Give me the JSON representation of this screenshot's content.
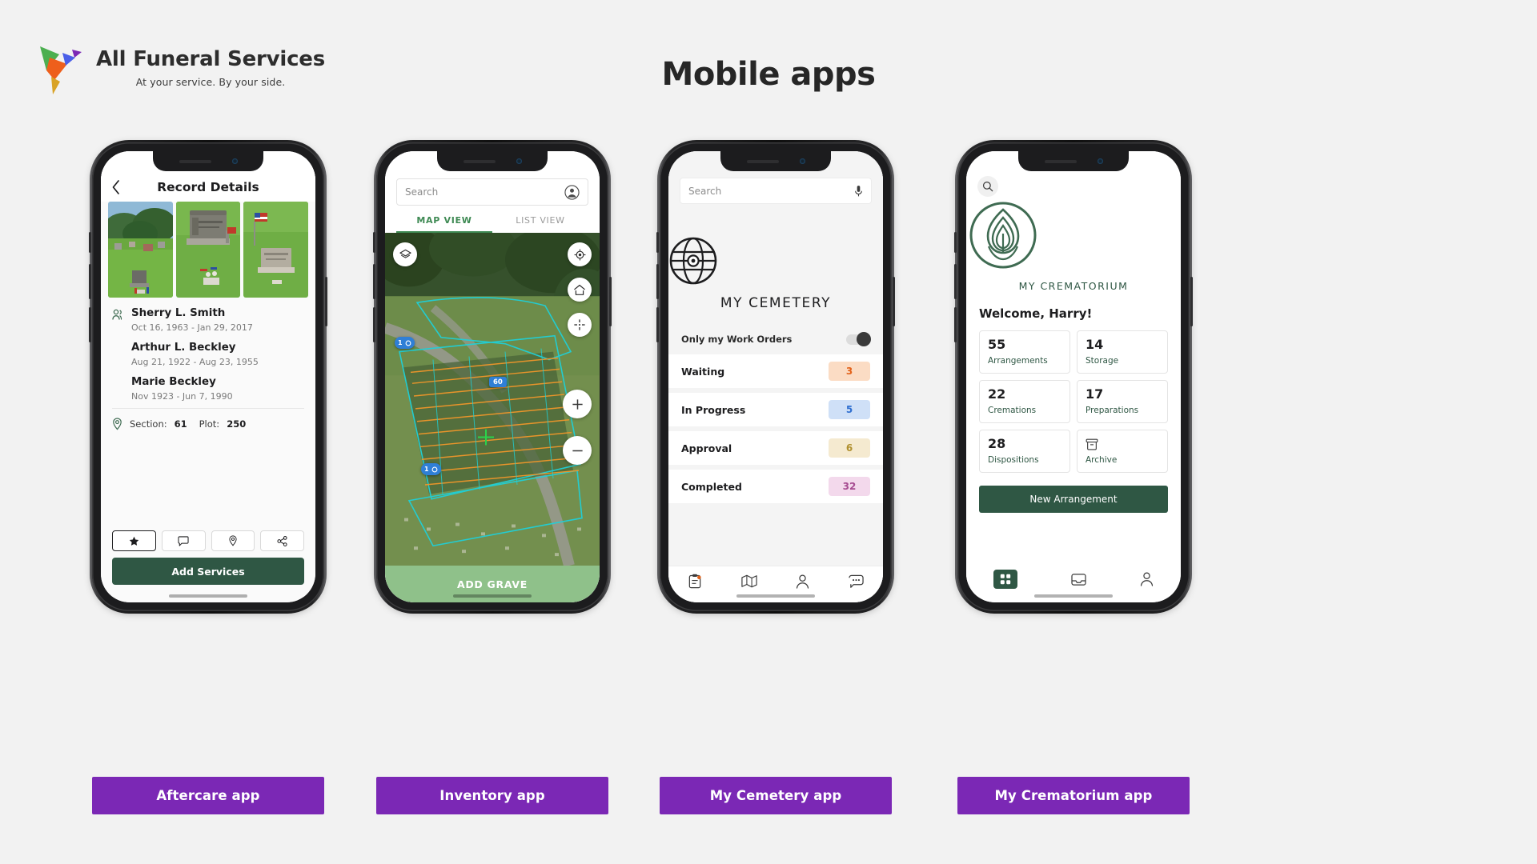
{
  "header": {
    "brand_name": "All Funeral Services",
    "tagline": "At your service. By your side.",
    "page_title": "Mobile apps",
    "logo_colors": {
      "green": "#4caf50",
      "orange": "#ee5f1c",
      "blue": "#4a5fe8",
      "purple": "#7b28b5",
      "gold": "#d9a326"
    }
  },
  "labels": {
    "aftercare": "Aftercare app",
    "inventory": "Inventory app",
    "cemetery": "My Cemetery app",
    "crematorium": "My Crematorium app",
    "label_color": "#7b28b5"
  },
  "aftercare": {
    "back_icon": "chevron-left-icon",
    "title": "Record Details",
    "photos": [
      "cemetery-landscape-photo",
      "beckley-headstone-photo",
      "headstone-flag-photo"
    ],
    "person_icon": "people-icon",
    "records": [
      {
        "name": "Sherry L. Smith",
        "dates": "Oct 16, 1963 - Jan 29, 2017"
      },
      {
        "name": "Arthur L. Beckley",
        "dates": "Aug 21, 1922 - Aug 23, 1955"
      },
      {
        "name": "Marie Beckley",
        "dates": "Nov 1923 - Jun 7, 1990"
      }
    ],
    "location_icon": "map-pin-icon",
    "section_label": "Section:",
    "section_value": "61",
    "plot_label": "Plot:",
    "plot_value": "250",
    "actions": [
      "star-icon",
      "comment-icon",
      "map-pin-icon",
      "share-icon"
    ],
    "cta": "Add Services",
    "cta_color": "#2f5744"
  },
  "inventory": {
    "search_placeholder": "Search",
    "account_icon": "account-circle-icon",
    "tabs": [
      {
        "label": "MAP VIEW",
        "active": true
      },
      {
        "label": "LIST VIEW",
        "active": false
      }
    ],
    "map_controls": [
      "layers-icon",
      "locate-icon",
      "home-icon",
      "center-crosshair-icon",
      "zoom-in-icon",
      "zoom-out-icon"
    ],
    "section_badge": "60",
    "pins": [
      {
        "count": "1"
      },
      {
        "count": "1"
      }
    ],
    "cta": "ADD GRAVE",
    "cta_color": "#8fc18a",
    "tab_active_color": "#3f8a54"
  },
  "cemetery": {
    "search_placeholder": "Search",
    "mic_icon": "microphone-icon",
    "logo_icon": "globe-grid-icon",
    "app_name": "MY CEMETERY",
    "toggle_label": "Only my Work Orders",
    "toggle_on": true,
    "statuses": [
      {
        "label": "Waiting",
        "count": "3",
        "bg": "#fbdcc4",
        "fg": "#e3621a"
      },
      {
        "label": "In Progress",
        "count": "5",
        "bg": "#cfe0f7",
        "fg": "#2f6fd0"
      },
      {
        "label": "Approval",
        "count": "6",
        "bg": "#f5ead0",
        "fg": "#b0902f"
      },
      {
        "label": "Completed",
        "count": "32",
        "bg": "#f3d9ec",
        "fg": "#a64b91"
      }
    ],
    "nav": [
      "clipboard-icon",
      "map-icon",
      "person-icon",
      "chat-icon"
    ]
  },
  "crematorium": {
    "search_icon": "search-icon",
    "logo_icon": "flame-leaf-icon",
    "app_name": "MY CREMATORIUM",
    "welcome": "Welcome, Harry!",
    "brand_color": "#2f5744",
    "stats": [
      {
        "value": "55",
        "label": "Arrangements"
      },
      {
        "value": "14",
        "label": "Storage"
      },
      {
        "value": "22",
        "label": "Cremations"
      },
      {
        "value": "17",
        "label": "Preparations"
      },
      {
        "value": "28",
        "label": "Dispositions"
      },
      {
        "value": "",
        "label": "Archive",
        "icon": "archive-box-icon"
      }
    ],
    "cta": "New Arrangement",
    "nav": [
      "grid-dashboard-icon",
      "inbox-icon",
      "person-icon"
    ]
  }
}
